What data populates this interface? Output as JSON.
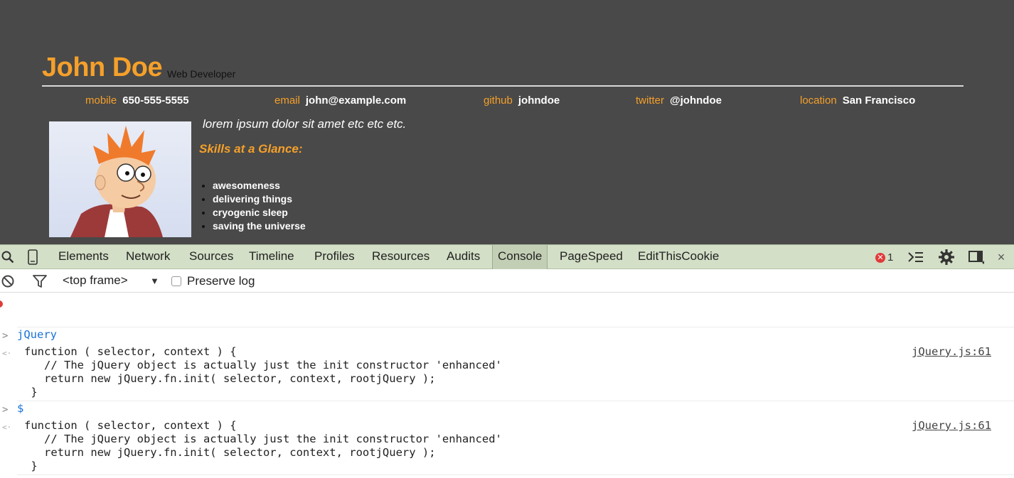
{
  "resume": {
    "name": "John Doe",
    "role": "Web Developer",
    "contacts": [
      {
        "label": "mobile",
        "value": "650-555-5555"
      },
      {
        "label": "email",
        "value": "john@example.com"
      },
      {
        "label": "github",
        "value": "johndoe"
      },
      {
        "label": "twitter",
        "value": "@johndoe"
      },
      {
        "label": "location",
        "value": "San Francisco"
      }
    ],
    "tagline": "lorem ipsum dolor sit amet etc etc etc.",
    "skills_title": "Skills at a Glance:",
    "skills": [
      "awesomeness",
      "delivering things",
      "cryogenic sleep",
      "saving the universe"
    ]
  },
  "devtools": {
    "tabs": [
      "Elements",
      "Network",
      "Sources",
      "Timeline",
      "Profiles",
      "Resources",
      "Audits",
      "Console",
      "PageSpeed",
      "EditThisCookie"
    ],
    "active_tab": "Console",
    "error_count": "1",
    "toolbar": {
      "frame": "<top frame>",
      "preserve_log_label": "Preserve log",
      "preserve_log_checked": false
    },
    "console": [
      {
        "input": "jQuery",
        "output": "function ( selector, context ) {\n   // The jQuery object is actually just the init constructor 'enhanced'\n   return new jQuery.fn.init( selector, context, rootjQuery );\n }",
        "source": "jQuery.js:61"
      },
      {
        "input": "$",
        "output": "function ( selector, context ) {\n   // The jQuery object is actually just the init constructor 'enhanced'\n   return new jQuery.fn.init( selector, context, rootjQuery );\n }",
        "source": "jQuery.js:61"
      }
    ]
  },
  "colors": {
    "accent": "#f5a02a",
    "page_bg": "#494949",
    "devtools_bar": "#d3dfc6",
    "console_input": "#1a72d6",
    "error": "#e23a3a"
  }
}
